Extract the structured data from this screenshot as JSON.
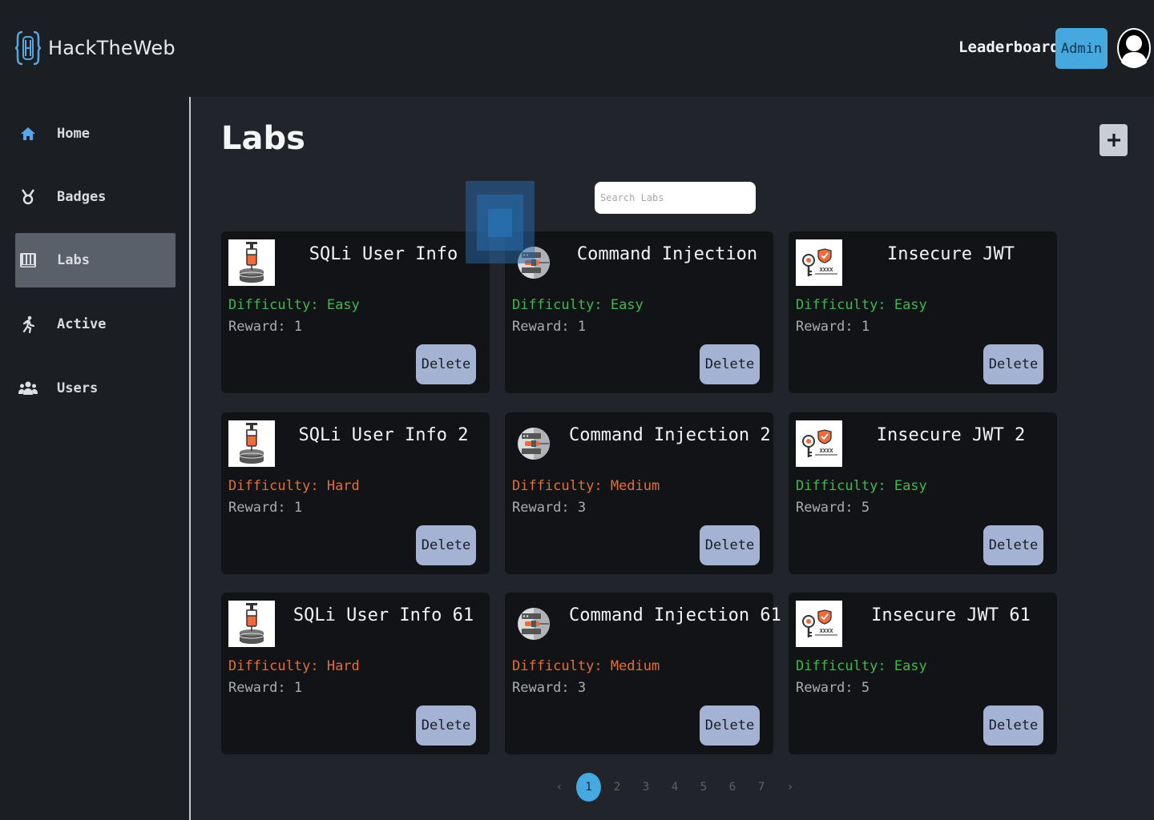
{
  "brand": {
    "name": "HackTheWeb"
  },
  "header": {
    "leaderboard": "Leaderboard",
    "admin": "Admin"
  },
  "sidebar": {
    "items": [
      {
        "label": "Home",
        "icon": "home-icon"
      },
      {
        "label": "Badges",
        "icon": "medal-icon"
      },
      {
        "label": "Labs",
        "icon": "flask-icon",
        "active": true
      },
      {
        "label": "Active",
        "icon": "running-icon"
      },
      {
        "label": "Users",
        "icon": "users-icon"
      }
    ]
  },
  "main": {
    "title": "Labs",
    "search": {
      "placeholder": "Search Labs",
      "value": ""
    },
    "difficulty_prefix": "Difficulty: ",
    "reward_prefix": "Reward: ",
    "delete_label": "Delete",
    "labs": [
      {
        "title": "SQLi User Info",
        "difficulty": "Easy",
        "reward": "1",
        "image": "sql-injection-icon"
      },
      {
        "title": "Command Injection",
        "difficulty": "Easy",
        "reward": "1",
        "image": "command-injection-icon"
      },
      {
        "title": "Insecure JWT",
        "difficulty": "Easy",
        "reward": "1",
        "image": "jwt-key-icon"
      },
      {
        "title": "SQLi User Info 2",
        "difficulty": "Hard",
        "reward": "1",
        "image": "sql-injection-icon"
      },
      {
        "title": "Command Injection 2",
        "difficulty": "Medium",
        "reward": "3",
        "image": "command-injection-icon"
      },
      {
        "title": "Insecure JWT 2",
        "difficulty": "Easy",
        "reward": "5",
        "image": "jwt-key-icon"
      },
      {
        "title": "SQLi User Info 61",
        "difficulty": "Hard",
        "reward": "1",
        "image": "sql-injection-icon"
      },
      {
        "title": "Command Injection 61",
        "difficulty": "Medium",
        "reward": "3",
        "image": "command-injection-icon"
      },
      {
        "title": "Insecure JWT 61",
        "difficulty": "Easy",
        "reward": "5",
        "image": "jwt-key-icon"
      }
    ]
  },
  "pagination": {
    "prev": "‹",
    "next": "›",
    "pages": [
      "1",
      "2",
      "3",
      "4",
      "5",
      "6",
      "7"
    ],
    "current": "1"
  },
  "colors": {
    "accent": "#45a8de",
    "easy": "#3fb950",
    "medium": "#e0703a",
    "hard": "#e0703a",
    "delete_button": "#a4b3d4"
  }
}
